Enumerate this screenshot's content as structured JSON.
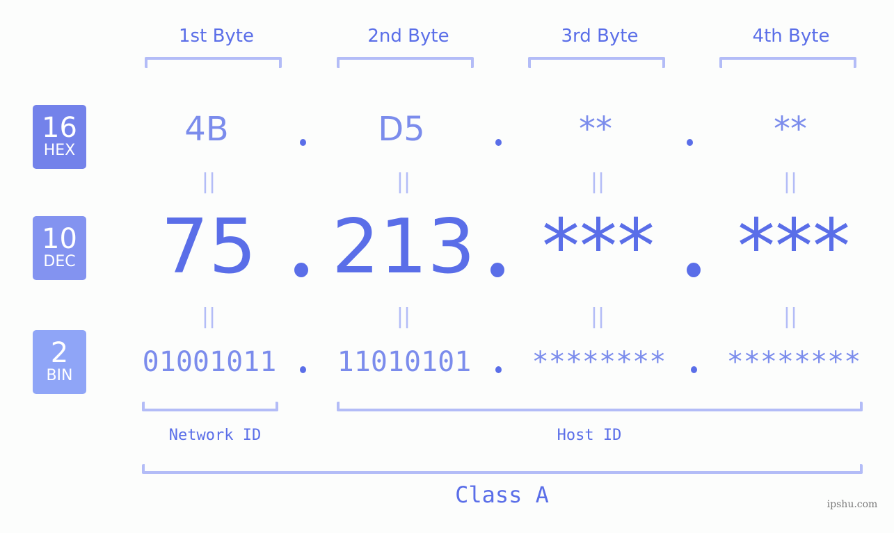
{
  "bytes": [
    {
      "label": "1st Byte",
      "hex": "4B",
      "dec": "75",
      "bin": "01001011"
    },
    {
      "label": "2nd Byte",
      "hex": "D5",
      "dec": "213",
      "bin": "11010101"
    },
    {
      "label": "3rd Byte",
      "hex": "**",
      "dec": "***",
      "bin": "********"
    },
    {
      "label": "4th Byte",
      "hex": "**",
      "dec": "***",
      "bin": "********"
    }
  ],
  "badges": {
    "hex": {
      "num": "16",
      "abbr": "HEX",
      "color": "#7382ea"
    },
    "dec": {
      "num": "10",
      "abbr": "DEC",
      "color": "#8393f0"
    },
    "bin": {
      "num": "2",
      "abbr": "BIN",
      "color": "#8fa5f7"
    }
  },
  "equals_symbol": "||",
  "network_id_label": "Network ID",
  "host_id_label": "Host ID",
  "class_label": "Class A",
  "watermark": "ipshu.com",
  "colors": {
    "accent": "#5a6ee8",
    "secondary": "#7b8cec",
    "bracket": "#b3bcf7",
    "background": "#fcfdfc"
  }
}
